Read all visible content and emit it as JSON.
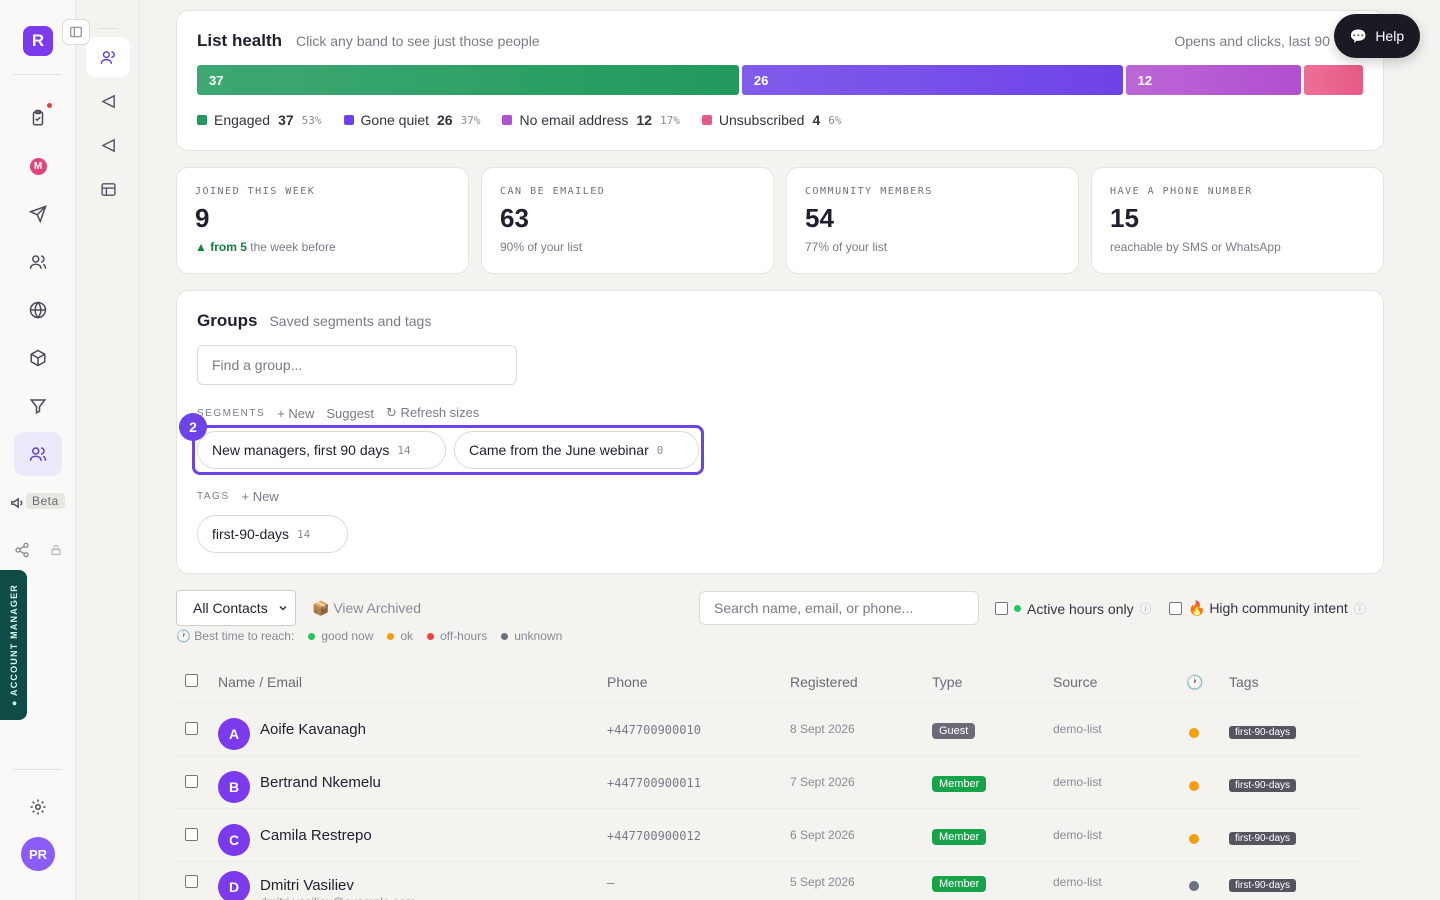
{
  "app": {
    "logo_letter": "R",
    "beta_label": "Beta",
    "account_manager": "● ACCOUNT MANAGER",
    "user_initials": "PR"
  },
  "list_health": {
    "title": "List health",
    "subtitle": "Click any band to see just those people",
    "right_note": "Opens and clicks, last 90",
    "bands": [
      {
        "label": "Engaged",
        "count": "37",
        "pct": "53%",
        "color": "#219a5e",
        "bar_label": "37"
      },
      {
        "label": "Gone quiet",
        "count": "26",
        "pct": "37%",
        "color": "#6d43e8",
        "bar_label": "26"
      },
      {
        "label": "No email address",
        "count": "12",
        "pct": "17%",
        "color": "#b14fd0",
        "bar_label": "12"
      },
      {
        "label": "Unsubscribed",
        "count": "4",
        "pct": "6%",
        "color": "#e85a86",
        "bar_label": ""
      }
    ]
  },
  "stats": [
    {
      "label": "JOINED THIS WEEK",
      "value": "9",
      "sub_strong": "▲ from 5",
      "sub": "the week before"
    },
    {
      "label": "CAN BE EMAILED",
      "value": "63",
      "sub_strong": "",
      "sub": "90% of your list"
    },
    {
      "label": "COMMUNITY MEMBERS",
      "value": "54",
      "sub_strong": "",
      "sub": "77% of your list"
    },
    {
      "label": "HAVE A PHONE NUMBER",
      "value": "15",
      "sub_strong": "",
      "sub": "reachable by SMS or WhatsApp"
    }
  ],
  "groups": {
    "title": "Groups",
    "subtitle": "Saved segments and tags",
    "search_placeholder": "Find a group...",
    "segments_label": "SEGMENTS",
    "new_label": "+ New",
    "suggest_label": "Suggest",
    "refresh_label": "↻ Refresh sizes",
    "step_badge": "2",
    "segments": [
      {
        "name": "New managers, first 90 days",
        "count": "14"
      },
      {
        "name": "Came from the June webinar",
        "count": "0"
      }
    ],
    "tags_label": "TAGS",
    "tags_new_label": "+ New",
    "tags": [
      {
        "name": "first-90-days",
        "count": "14"
      }
    ]
  },
  "filters": {
    "contacts_select": "All Contacts",
    "view_archived": "📦 View Archived",
    "search_placeholder": "Search name, email, or phone...",
    "active_hours": "Active hours only",
    "high_intent": "🔥 High community intent",
    "best_time_label": "🕐 Best time to reach:",
    "legend": [
      {
        "label": "good now",
        "color": "#22c55e"
      },
      {
        "label": "ok",
        "color": "#f59e0b"
      },
      {
        "label": "off-hours",
        "color": "#ef4444"
      },
      {
        "label": "unknown",
        "color": "#6b7280"
      }
    ]
  },
  "table": {
    "headers": {
      "name": "Name / Email",
      "phone": "Phone",
      "registered": "Registered",
      "type": "Type",
      "source": "Source",
      "time": "🕐",
      "tags": "Tags"
    },
    "rows": [
      {
        "initial": "A",
        "name": "Aoife Kavanagh",
        "email": "",
        "phone": "+447700900010",
        "registered": "8 Sept 2026",
        "type": "Guest",
        "type_color": "#6b6b78",
        "source": "demo-list",
        "time_color": "#f59e0b",
        "tag": "first-90-days"
      },
      {
        "initial": "B",
        "name": "Bertrand Nkemelu",
        "email": "",
        "phone": "+447700900011",
        "registered": "7 Sept 2026",
        "type": "Member",
        "type_color": "#16a34a",
        "source": "demo-list",
        "time_color": "#f59e0b",
        "tag": "first-90-days"
      },
      {
        "initial": "C",
        "name": "Camila Restrepo",
        "email": "",
        "phone": "+447700900012",
        "registered": "6 Sept 2026",
        "type": "Member",
        "type_color": "#16a34a",
        "source": "demo-list",
        "time_color": "#f59e0b",
        "tag": "first-90-days"
      },
      {
        "initial": "D",
        "name": "Dmitri Vasiliev",
        "email": "dmitri.vasiliev@example.com",
        "phone": "–",
        "registered": "5 Sept 2026",
        "type": "Member",
        "type_color": "#16a34a",
        "source": "demo-list",
        "time_color": "#6b7280",
        "tag": "first-90-days"
      }
    ]
  },
  "help": {
    "label": "Help"
  }
}
